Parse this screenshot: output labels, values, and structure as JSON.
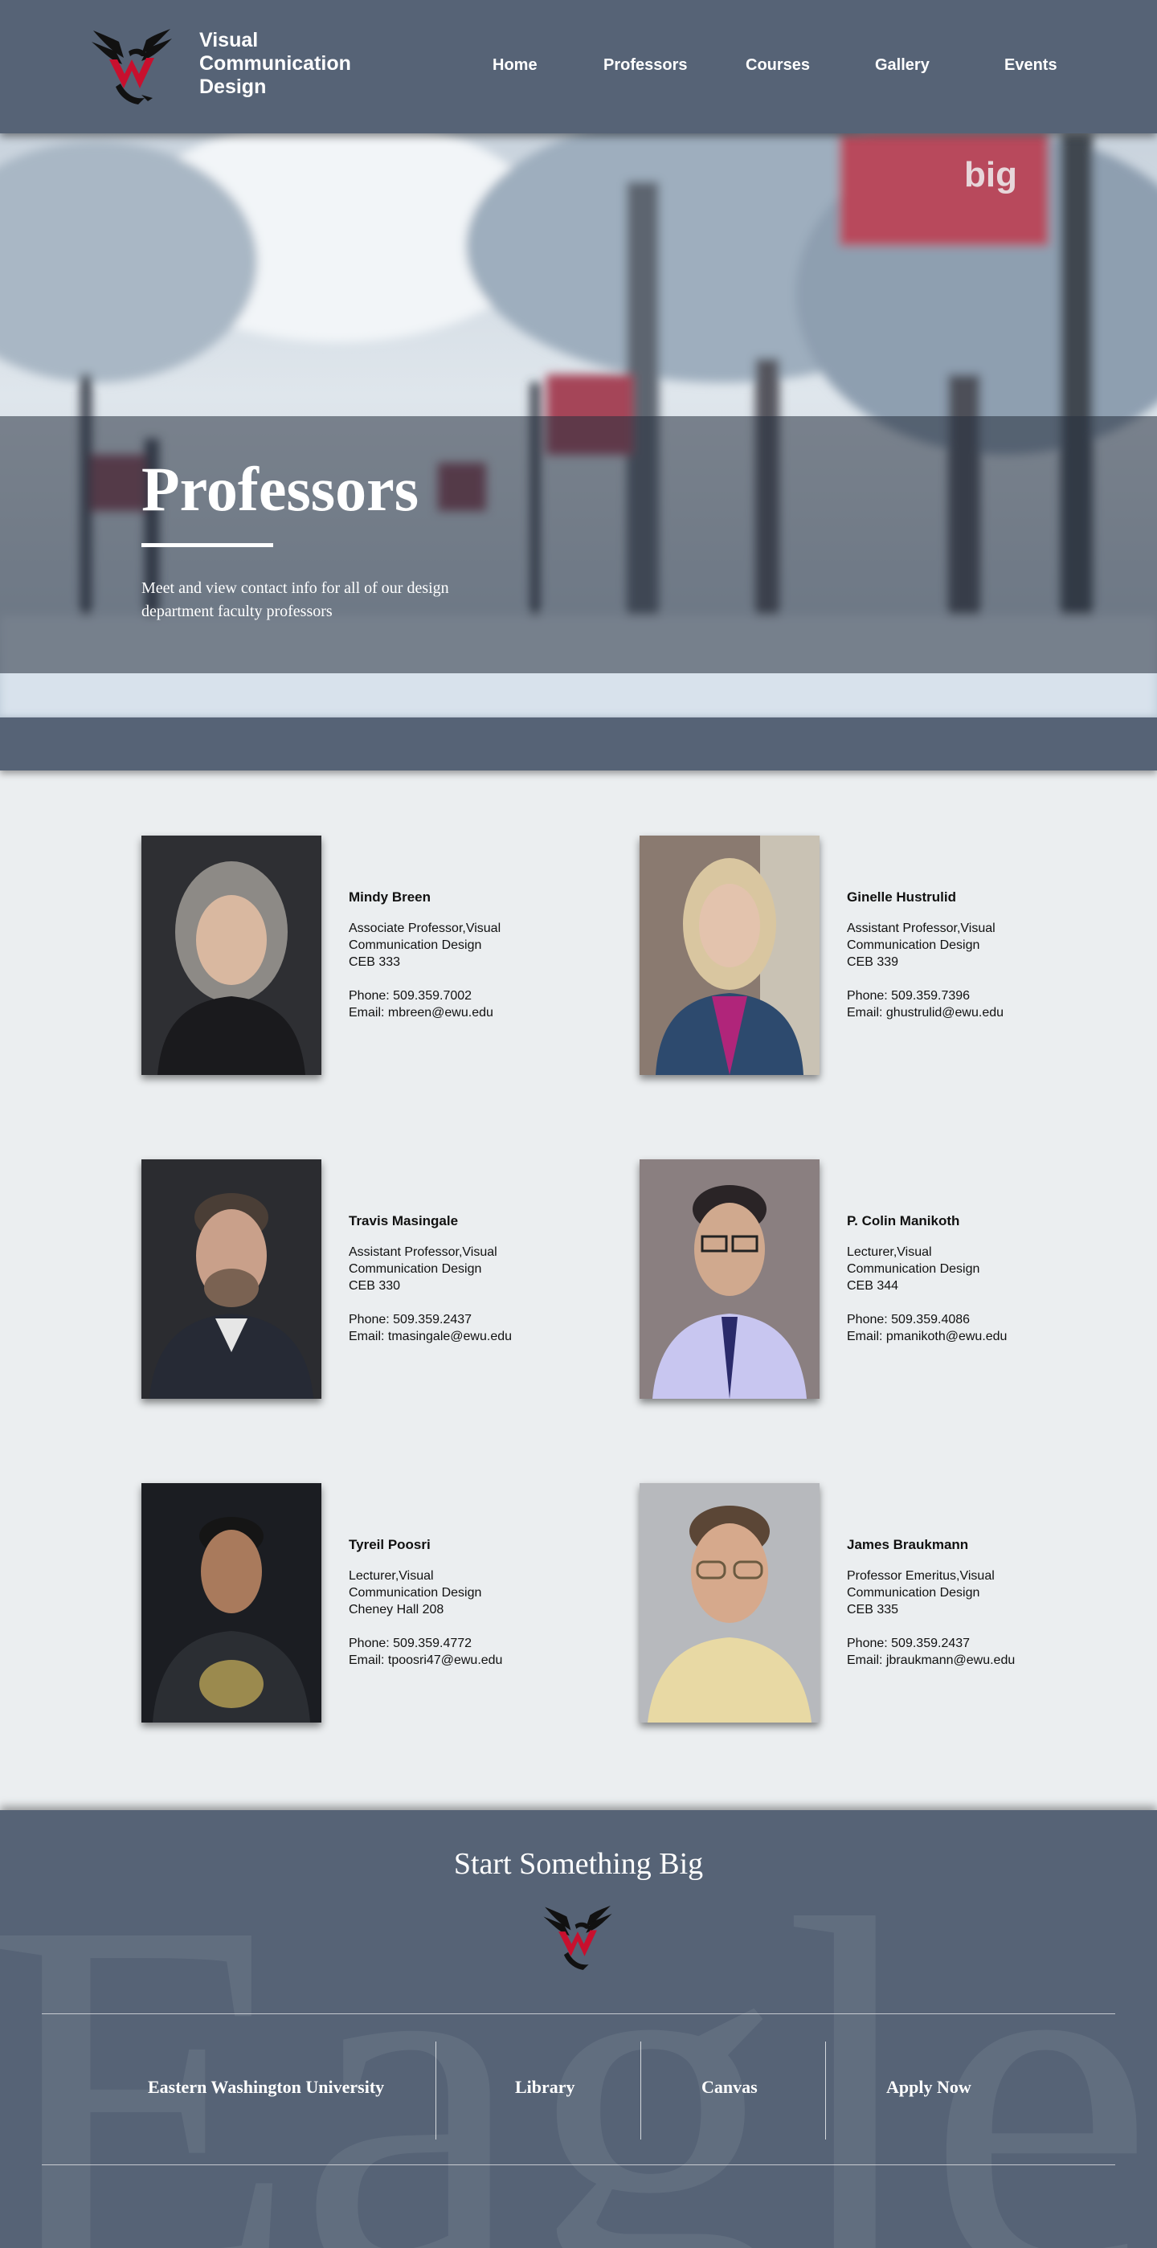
{
  "header": {
    "brand_lines": [
      "Visual",
      "Communication",
      "Design"
    ],
    "nav": [
      "Home",
      "Professors",
      "Courses",
      "Gallery",
      "Events"
    ]
  },
  "hero": {
    "title": "Professors",
    "subtitle": "Meet and view contact info for all of our design department faculty professors",
    "sign_text": "big"
  },
  "faculty": [
    {
      "name": "Mindy Breen",
      "title_line1": "Associate Professor,Visual",
      "title_line2": "Communication Design",
      "office": "CEB 333",
      "phone": "Phone: 509.359.7002",
      "email": "Email: mbreen@ewu.edu"
    },
    {
      "name": "Ginelle Hustrulid",
      "title_line1": "Assistant Professor,Visual",
      "title_line2": "Communication Design",
      "office": "CEB 339",
      "phone": "Phone: 509.359.7396",
      "email": "Email: ghustrulid@ewu.edu"
    },
    {
      "name": "Travis Masingale",
      "title_line1": "Assistant Professor,Visual",
      "title_line2": "Communication Design",
      "office": "CEB 330",
      "phone": "Phone: 509.359.2437",
      "email": "Email: tmasingale@ewu.edu"
    },
    {
      "name": "P. Colin Manikoth",
      "title_line1": "Lecturer,Visual",
      "title_line2": "Communication Design",
      "office": "CEB 344",
      "phone": "Phone: 509.359.4086",
      "email": "Email: pmanikoth@ewu.edu"
    },
    {
      "name": "Tyreil Poosri",
      "title_line1": "Lecturer,Visual",
      "title_line2": "Communication Design",
      "office": "Cheney Hall 208",
      "phone": "Phone: 509.359.4772",
      "email": "Email: tpoosri47@ewu.edu"
    },
    {
      "name": "James Braukmann",
      "title_line1": "Professor Emeritus,Visual",
      "title_line2": "Communication Design",
      "office": "CEB 335",
      "phone": "Phone: 509.359.2437",
      "email": "Email: jbraukmann@ewu.edu"
    }
  ],
  "footer": {
    "tagline": "Start Something Big",
    "watermark": "Eagles",
    "links": [
      "Eastern Washington University",
      "Library",
      "Canvas",
      "Apply Now"
    ]
  },
  "colors": {
    "header_bg": "#566376",
    "page_bg": "#ebeef0",
    "brand_red": "#c8102e"
  },
  "icons": {
    "logo": "eagle-logo-icon"
  }
}
